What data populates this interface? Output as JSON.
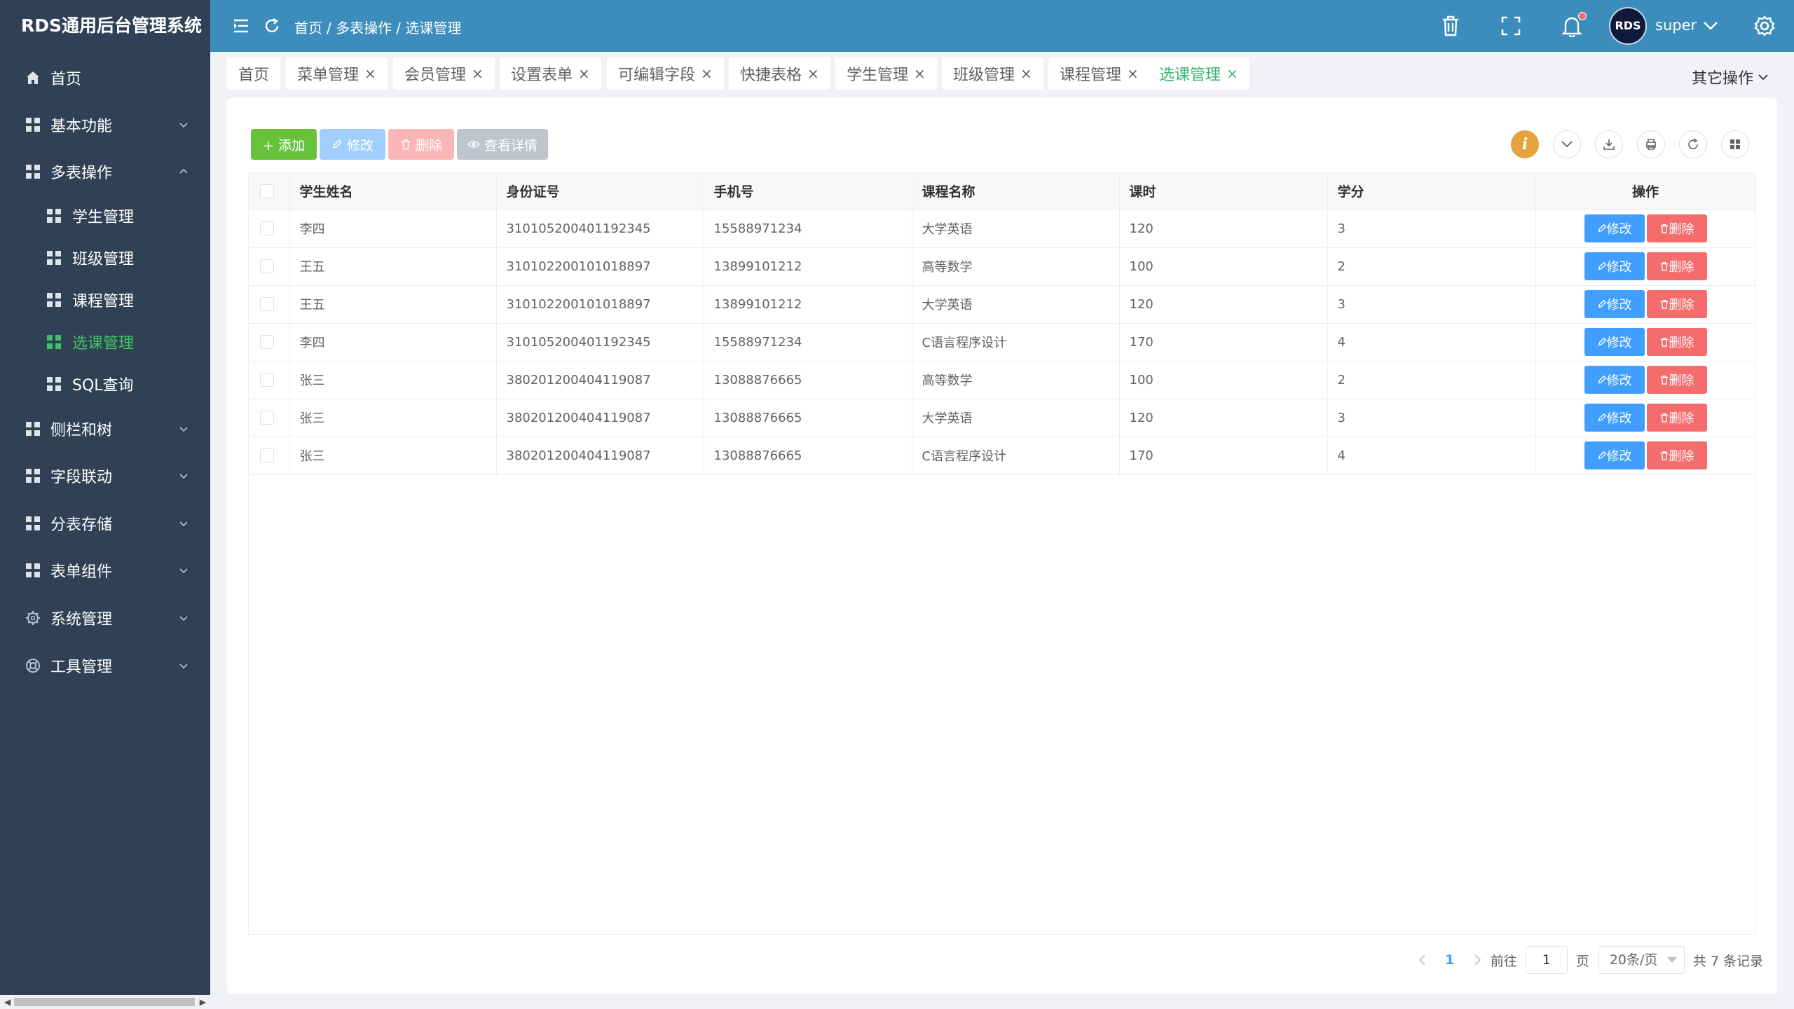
{
  "app": {
    "title": "RDS通用后台管理系统"
  },
  "sidebar": {
    "items": [
      {
        "label": "首页",
        "icon": "home-icon"
      },
      {
        "label": "基本功能",
        "icon": "grid-icon"
      },
      {
        "label": "多表操作",
        "icon": "grid-icon"
      },
      {
        "label": "学生管理",
        "icon": "grid-icon"
      },
      {
        "label": "班级管理",
        "icon": "grid-icon"
      },
      {
        "label": "课程管理",
        "icon": "grid-icon"
      },
      {
        "label": "选课管理",
        "icon": "grid-icon"
      },
      {
        "label": "SQL查询",
        "icon": "grid-icon"
      },
      {
        "label": "侧栏和树",
        "icon": "grid-icon"
      },
      {
        "label": "字段联动",
        "icon": "grid-icon"
      },
      {
        "label": "分表存储",
        "icon": "grid-icon"
      },
      {
        "label": "表单组件",
        "icon": "grid-icon"
      },
      {
        "label": "系统管理",
        "icon": "gear-icon"
      },
      {
        "label": "工具管理",
        "icon": "lifebuoy-icon"
      }
    ],
    "active": "选课管理"
  },
  "header": {
    "breadcrumb": [
      "首页",
      "/ 多表操作",
      "/ 选课管理"
    ],
    "user": "super",
    "avatar_text": "RDS"
  },
  "tabs": {
    "items": [
      "首页",
      "菜单管理",
      "会员管理",
      "设置表单",
      "可编辑字段",
      "快捷表格",
      "学生管理",
      "班级管理",
      "课程管理",
      "选课管理"
    ],
    "active": "选课管理",
    "close_glyph": "×",
    "other_ops": "其它操作"
  },
  "toolbar": {
    "add": "+ 添加",
    "edit": "修改",
    "delete": "删除",
    "view": "查看详情",
    "info": "i"
  },
  "table": {
    "columns": [
      "学生姓名",
      "身份证号",
      "手机号",
      "课程名称",
      "课时",
      "学分",
      "操作"
    ],
    "rows": [
      [
        "李四",
        "310105200401192345",
        "15588971234",
        "大学英语",
        "120",
        "3"
      ],
      [
        "王五",
        "310102200101018897",
        "13899101212",
        "高等数学",
        "100",
        "2"
      ],
      [
        "王五",
        "310102200101018897",
        "13899101212",
        "大学英语",
        "120",
        "3"
      ],
      [
        "李四",
        "310105200401192345",
        "15588971234",
        "C语言程序设计",
        "170",
        "4"
      ],
      [
        "张三",
        "380201200404119087",
        "13088876665",
        "高等数学",
        "100",
        "2"
      ],
      [
        "张三",
        "380201200404119087",
        "13088876665",
        "大学英语",
        "120",
        "3"
      ],
      [
        "张三",
        "380201200404119087",
        "13088876665",
        "C语言程序设计",
        "170",
        "4"
      ]
    ],
    "row_edit": "修改",
    "row_delete": "删除"
  },
  "pager": {
    "current": "1",
    "goto_label": "前往",
    "goto_value": "1",
    "page_unit": "页",
    "page_size": "20条/页",
    "total": "共 7 条记录"
  },
  "colors": {
    "sidebar_bg": "#304156",
    "header_bg": "#3c8dbc",
    "active_green": "#40c463",
    "primary": "#409eff",
    "danger": "#f56c6c"
  }
}
